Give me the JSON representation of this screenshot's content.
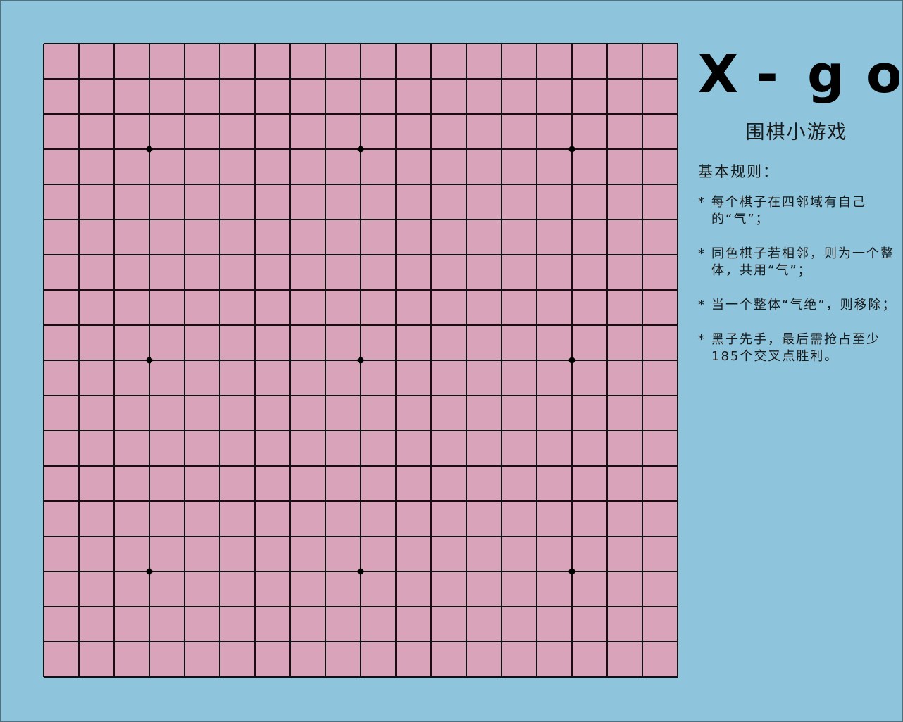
{
  "app": {
    "logo": [
      "X",
      "-",
      "g",
      "o"
    ],
    "subtitle": "围棋小游戏"
  },
  "rules": {
    "heading": "基本规则：",
    "marker": "*",
    "items": [
      "每个棋子在四邻域有自己的“气”；",
      "同色棋子若相邻，则为一个整体，共用“气”；",
      "当一个整体“气绝”，则移除；",
      "黑子先手，最后需抢占至少185个交叉点胜利。"
    ]
  },
  "board": {
    "lines": 19,
    "star_points": [
      [
        3,
        3
      ],
      [
        9,
        3
      ],
      [
        15,
        3
      ],
      [
        3,
        9
      ],
      [
        9,
        9
      ],
      [
        15,
        9
      ],
      [
        3,
        15
      ],
      [
        9,
        15
      ],
      [
        15,
        15
      ]
    ],
    "stones": []
  },
  "colors": {
    "background": "#8ec5dc",
    "board": "#d9a3b9",
    "grid": "#111111",
    "star": "#000000"
  }
}
